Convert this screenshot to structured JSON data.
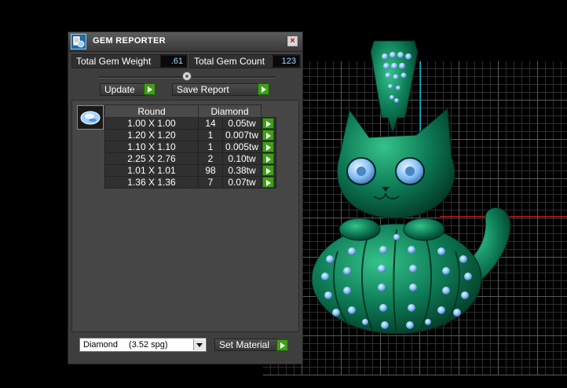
{
  "window": {
    "title": "GEM REPORTER",
    "close_glyph": "×"
  },
  "summary": {
    "total_gem_weight_label": "Total Gem Weight",
    "total_gem_weight_value": ".61",
    "total_gem_count_label": "Total Gem Count",
    "total_gem_count_value": "123"
  },
  "toolbar": {
    "update_label": "Update",
    "save_report_label": "Save Report"
  },
  "table": {
    "headers": [
      "Round",
      "Diamond"
    ],
    "rows": [
      {
        "size": "1.00 X 1.00",
        "count": "14",
        "weight": "0.05tw"
      },
      {
        "size": "1.20 X 1.20",
        "count": "1",
        "weight": "0.007tw"
      },
      {
        "size": "1.10 X 1.10",
        "count": "1",
        "weight": "0.005tw"
      },
      {
        "size": "2.25 X 2.76",
        "count": "2",
        "weight": "0.10tw"
      },
      {
        "size": "1.01 X 1.01",
        "count": "98",
        "weight": "0.38tw"
      },
      {
        "size": "1.36 X 1.36",
        "count": "7",
        "weight": "0.07tw"
      }
    ]
  },
  "material": {
    "selected_name": "Diamond",
    "selected_spg": "(3.52 spg)",
    "set_material_label": "Set Material"
  },
  "colors": {
    "model": "#0d7a55",
    "gem_blue": "#7fbcf2",
    "action_green": "#3fa018",
    "axis_cyan": "#00b8d4",
    "axis_red": "#d82020"
  },
  "icons": {
    "title": "gem-reporter-app-icon",
    "gem_shape": "round-gem-icon",
    "row_action": "play-arrow-icon"
  }
}
